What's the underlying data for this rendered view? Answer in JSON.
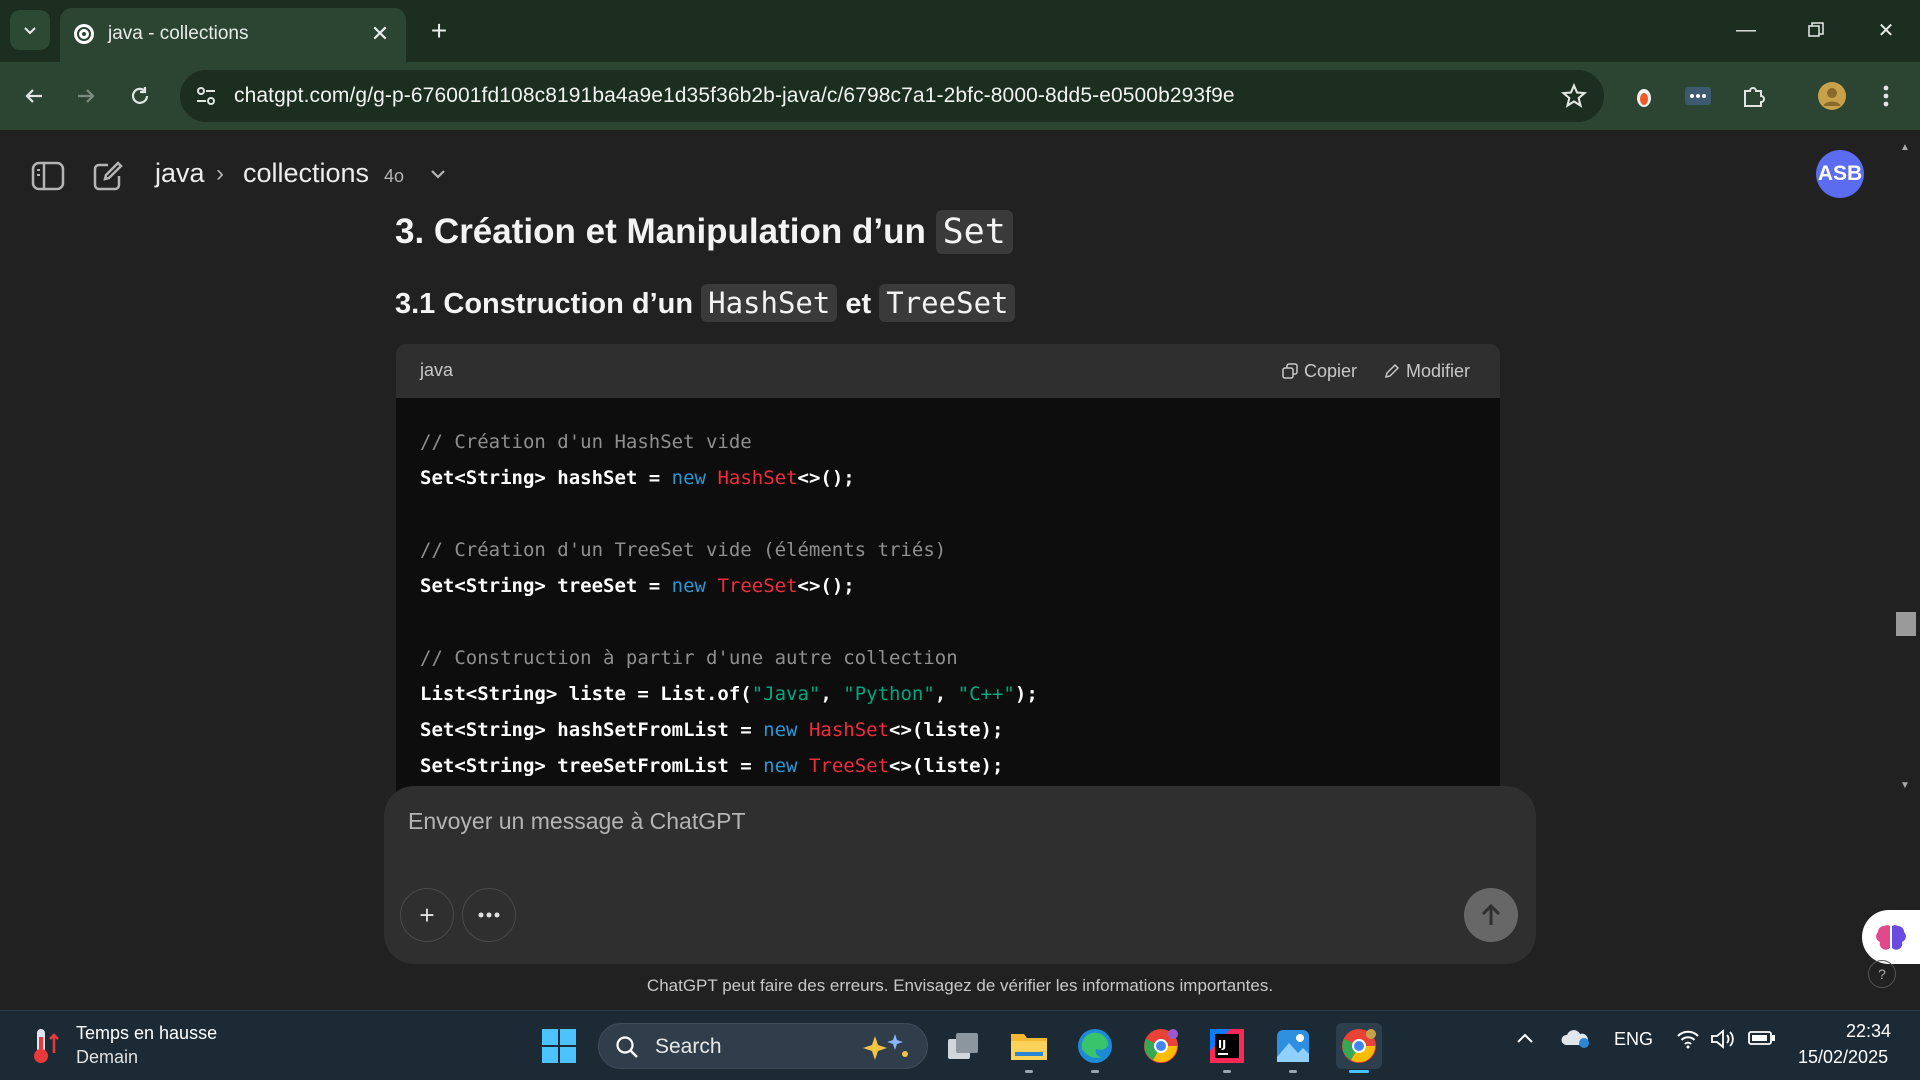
{
  "browser": {
    "tab_title": "java - collections",
    "url": "chatgpt.com/g/g-p-676001fd108c8191ba4a9e1d35f36b2b-java/c/6798c7a1-2bfc-8000-8dd5-e0500b293f9e"
  },
  "header": {
    "project": "java",
    "chat": "collections",
    "model": "4o",
    "avatar": "ASB"
  },
  "content": {
    "h3_text": "3. Création et Manipulation d’un",
    "h3_code": "Set",
    "h4_text": "3.1 Construction d’un",
    "h4_code1": "HashSet",
    "h4_and": "et",
    "h4_code2": "TreeSet"
  },
  "code_block": {
    "language": "java",
    "copy_label": "Copier",
    "edit_label": "Modifier",
    "lines": [
      [
        [
          "c-com",
          "// Création d'un HashSet vide"
        ]
      ],
      [
        [
          "c-pl",
          "Set<String> hashSet = "
        ],
        [
          "c-kw",
          "new"
        ],
        [
          "c-pl",
          " "
        ],
        [
          "c-cls",
          "HashSet"
        ],
        [
          "c-pl",
          "<>();"
        ]
      ],
      [],
      [
        [
          "c-com",
          "// Création d'un TreeSet vide (éléments triés)"
        ]
      ],
      [
        [
          "c-pl",
          "Set<String> treeSet = "
        ],
        [
          "c-kw",
          "new"
        ],
        [
          "c-pl",
          " "
        ],
        [
          "c-cls",
          "TreeSet"
        ],
        [
          "c-pl",
          "<>();"
        ]
      ],
      [],
      [
        [
          "c-com",
          "// Construction à partir d'une autre collection"
        ]
      ],
      [
        [
          "c-pl",
          "List<String> liste = List.of("
        ],
        [
          "c-str",
          "\"Java\""
        ],
        [
          "c-pl",
          ", "
        ],
        [
          "c-str",
          "\"Python\""
        ],
        [
          "c-pl",
          ", "
        ],
        [
          "c-str",
          "\"C++\""
        ],
        [
          "c-pl",
          ");"
        ]
      ],
      [
        [
          "c-pl",
          "Set<String> hashSetFromList = "
        ],
        [
          "c-kw",
          "new"
        ],
        [
          "c-pl",
          " "
        ],
        [
          "c-cls",
          "HashSet"
        ],
        [
          "c-pl",
          "<>(liste);"
        ]
      ],
      [
        [
          "c-pl",
          "Set<String> treeSetFromList = "
        ],
        [
          "c-kw",
          "new"
        ],
        [
          "c-pl",
          " "
        ],
        [
          "c-cls",
          "TreeSet"
        ],
        [
          "c-pl",
          "<>(liste);"
        ]
      ]
    ]
  },
  "composer": {
    "placeholder": "Envoyer un message à ChatGPT",
    "disclaimer": "ChatGPT peut faire des erreurs. Envisagez de vérifier les informations importantes."
  },
  "taskbar": {
    "weather_line1": "Temps en hausse",
    "weather_line2": "Demain",
    "search_label": "Search",
    "language": "ENG",
    "time": "22:34",
    "date": "15/02/2025"
  },
  "colors": {
    "brand_chrome": "#2b4532",
    "page_bg": "#212121",
    "avatar": "#5b6cf0",
    "code_keyword": "#2e95d3",
    "code_class": "#f22c3d",
    "code_string": "#00a67d"
  }
}
